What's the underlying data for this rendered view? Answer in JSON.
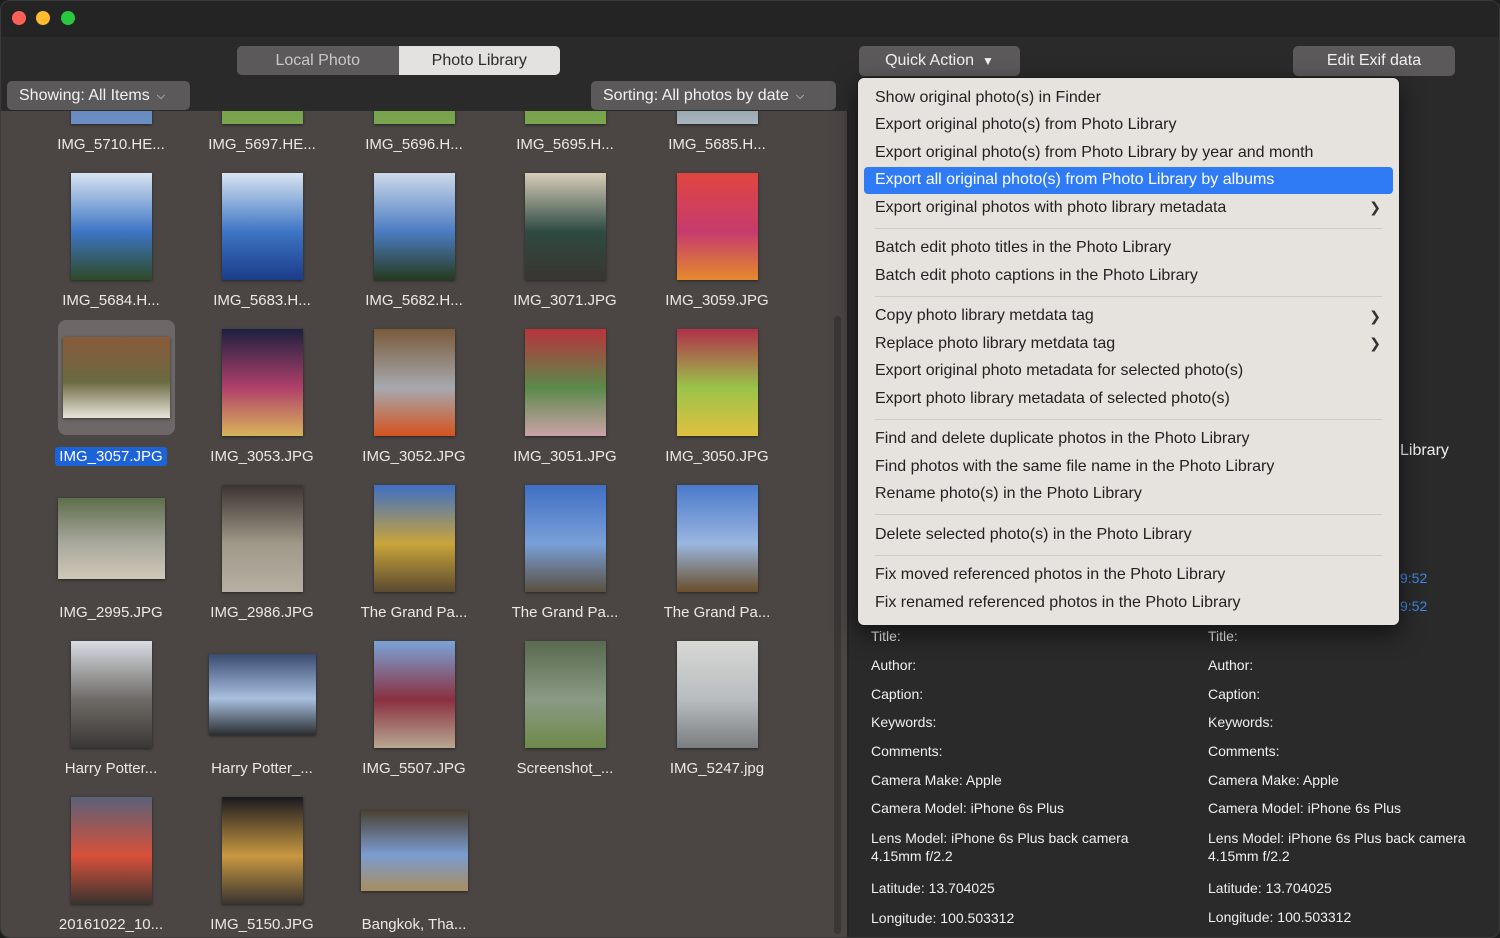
{
  "window": {
    "controls": [
      "close",
      "minimize",
      "zoom"
    ]
  },
  "toolbar": {
    "source_tabs": [
      {
        "label": "Local Photo",
        "active": false
      },
      {
        "label": "Photo Library",
        "active": true
      }
    ],
    "showing_label": "Showing: All Items",
    "sorting_label": "Sorting: All photos by date",
    "quick_action_label": "Quick Action",
    "edit_exif_label": "Edit Exif data"
  },
  "grid": {
    "selected_name": "IMG_3057.JPG",
    "rows": [
      [
        {
          "name": "IMG_5710.HE...",
          "colors": [
            "#4f74ad",
            "#6b8fc3"
          ],
          "orientation": "partial"
        },
        {
          "name": "IMG_5697.HE...",
          "colors": [
            "#5c8a3a",
            "#7aa64f"
          ],
          "orientation": "partial"
        },
        {
          "name": "IMG_5696.H...",
          "colors": [
            "#5c8a3a",
            "#7aa64f"
          ],
          "orientation": "partial"
        },
        {
          "name": "IMG_5695.H...",
          "colors": [
            "#5c8a3a",
            "#7aa64f"
          ],
          "orientation": "partial"
        },
        {
          "name": "IMG_5685.H...",
          "colors": [
            "#3c4a55",
            "#a6b5be"
          ],
          "orientation": "partial"
        }
      ],
      [
        {
          "name": "IMG_5684.H...",
          "colors": [
            "#d9e4f0",
            "#3d75c4",
            "#2e4a26"
          ],
          "orientation": "portrait"
        },
        {
          "name": "IMG_5683.H...",
          "colors": [
            "#d9e4f0",
            "#3d75c4",
            "#1b3c8a"
          ],
          "orientation": "portrait"
        },
        {
          "name": "IMG_5682.H...",
          "colors": [
            "#cdd9ea",
            "#4b7cc2",
            "#263a1e"
          ],
          "orientation": "portrait"
        },
        {
          "name": "IMG_3071.JPG",
          "colors": [
            "#d7cdb8",
            "#2e4a42",
            "#3a3530"
          ],
          "orientation": "portrait"
        },
        {
          "name": "IMG_3059.JPG",
          "colors": [
            "#e0463f",
            "#c63b6e",
            "#e48a2c"
          ],
          "orientation": "portrait"
        }
      ],
      [
        {
          "name": "IMG_3057.JPG",
          "colors": [
            "#8a5a3c",
            "#6b6a40",
            "#e8e4dc"
          ],
          "orientation": "landscape",
          "selected": true
        },
        {
          "name": "IMG_3053.JPG",
          "colors": [
            "#1d2040",
            "#b0406a",
            "#d8b45a"
          ],
          "orientation": "portrait"
        },
        {
          "name": "IMG_3052.JPG",
          "colors": [
            "#7a5a3a",
            "#a6a9b0",
            "#d4521e"
          ],
          "orientation": "portrait"
        },
        {
          "name": "IMG_3051.JPG",
          "colors": [
            "#b8343c",
            "#5b8a4a",
            "#caa2a8"
          ],
          "orientation": "portrait"
        },
        {
          "name": "IMG_3050.JPG",
          "colors": [
            "#b0304a",
            "#9ac44a",
            "#e0c040"
          ],
          "orientation": "portrait"
        }
      ],
      [
        {
          "name": "IMG_2995.JPG",
          "colors": [
            "#5d6e4a",
            "#a8a79c",
            "#cfc8b8"
          ],
          "orientation": "landscape"
        },
        {
          "name": "IMG_2986.JPG",
          "colors": [
            "#3c3430",
            "#a09888",
            "#b6b0a4"
          ],
          "orientation": "portrait"
        },
        {
          "name": "The Grand Pa...",
          "colors": [
            "#3f6fc4",
            "#c9a43a",
            "#5a4a30"
          ],
          "orientation": "portrait"
        },
        {
          "name": "The Grand Pa...",
          "colors": [
            "#3f6fc4",
            "#7aa0d8",
            "#5a5040"
          ],
          "orientation": "portrait"
        },
        {
          "name": "The Grand Pa...",
          "colors": [
            "#4a7acb",
            "#9ab6e0",
            "#6a4e2a"
          ],
          "orientation": "portrait"
        }
      ],
      [
        {
          "name": "Harry Potter...",
          "colors": [
            "#d8dce4",
            "#6e6a66",
            "#3a3836"
          ],
          "orientation": "portrait"
        },
        {
          "name": "Harry Potter_...",
          "colors": [
            "#3a4a70",
            "#a9c0e0",
            "#2a2e30"
          ],
          "orientation": "landscape"
        },
        {
          "name": "IMG_5507.JPG",
          "colors": [
            "#7aa4d8",
            "#8a3040",
            "#b8a890"
          ],
          "orientation": "portrait"
        },
        {
          "name": "Screenshot_...",
          "colors": [
            "#5a6a50",
            "#8a9a84",
            "#6e8a4a"
          ],
          "orientation": "portrait"
        },
        {
          "name": "IMG_5247.jpg",
          "colors": [
            "#d8d8d4",
            "#b8bcc0",
            "#7a7e80"
          ],
          "orientation": "portrait"
        }
      ],
      [
        {
          "name": "20161022_10...",
          "colors": [
            "#5a6278",
            "#d8503a",
            "#3a3430"
          ],
          "orientation": "portrait"
        },
        {
          "name": "IMG_5150.JPG",
          "colors": [
            "#1a1a20",
            "#c89840",
            "#3a3430"
          ],
          "orientation": "portrait"
        },
        {
          "name": "Bangkok, Tha...",
          "colors": [
            "#4a4030",
            "#7a9cd0",
            "#a88e60"
          ],
          "orientation": "landscape"
        }
      ]
    ]
  },
  "info": {
    "partial_heading": "Library",
    "partial_times": [
      "9:52",
      "9:52"
    ],
    "columns": [
      {
        "title": "Title:",
        "author": "Author:",
        "caption": "Caption:",
        "keywords": "Keywords:",
        "comments": "Comments:",
        "camera_make": "Camera Make: Apple",
        "camera_model": "Camera Model: iPhone 6s Plus",
        "lens_model_1": "Lens Model: iPhone 6s Plus back camera",
        "lens_model_2": "4.15mm f/2.2",
        "latitude": "Latitude: 13.704025",
        "longitude": "Longitude: 100.503312"
      },
      {
        "title": "Title:",
        "author": "Author:",
        "caption": "Caption:",
        "keywords": "Keywords:",
        "comments": "Comments:",
        "camera_make": "Camera Make: Apple",
        "camera_model": "Camera Model: iPhone 6s Plus",
        "lens_model_1": "Lens Model: iPhone 6s Plus back camera",
        "lens_model_2": "4.15mm f/2.2",
        "latitude": "Latitude: 13.704025",
        "longitude": "Longitude: 100.503312"
      }
    ]
  },
  "quick_action_menu": {
    "groups": [
      [
        {
          "label": "Show original photo(s) in Finder"
        },
        {
          "label": "Export original photo(s) from Photo Library"
        },
        {
          "label": "Export original photo(s) from Photo Library by year and month"
        },
        {
          "label": "Export all original photo(s) from Photo Library by albums",
          "highlighted": true
        },
        {
          "label": "Export original photos with photo library metadata",
          "submenu": true
        }
      ],
      [
        {
          "label": "Batch edit photo titles in the Photo Library"
        },
        {
          "label": "Batch edit photo captions in the Photo Library"
        }
      ],
      [
        {
          "label": "Copy photo library metdata tag",
          "submenu": true
        },
        {
          "label": "Replace photo library metdata tag",
          "submenu": true
        },
        {
          "label": "Export original photo metadata for selected photo(s)"
        },
        {
          "label": "Export photo library metadata of selected photo(s)"
        }
      ],
      [
        {
          "label": "Find and delete duplicate photos in the Photo Library"
        },
        {
          "label": "Find photos with the same file name in the Photo Library"
        },
        {
          "label": "Rename photo(s) in the Photo Library"
        }
      ],
      [
        {
          "label": "Delete selected photo(s) in the Photo Library"
        }
      ],
      [
        {
          "label": "Fix moved referenced photos in the Photo Library"
        },
        {
          "label": "Fix renamed referenced photos in the Photo Library"
        }
      ]
    ]
  },
  "colors": {
    "accent": "#2f7bf6",
    "selection_label": "#1d63d8",
    "link_time": "#3d8ae8"
  }
}
